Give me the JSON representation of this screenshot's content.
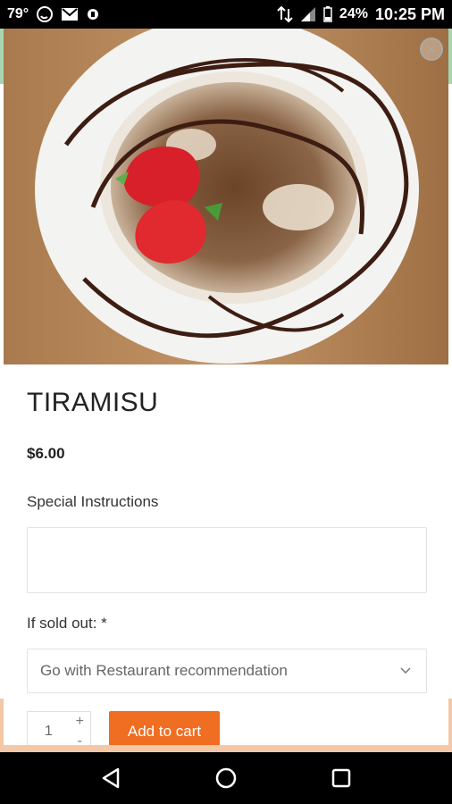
{
  "status_bar": {
    "temperature": "79°",
    "battery": "24%",
    "time": "10:25 PM",
    "icons": [
      "whatsapp-icon",
      "gmail-icon",
      "notification-icon",
      "data-transfer-icon",
      "signal-icon",
      "battery-icon"
    ]
  },
  "product": {
    "title": "TIRAMISU",
    "price": "$6.00"
  },
  "form": {
    "special_instructions_label": "Special Instructions",
    "special_instructions_value": "",
    "sold_out_label": "If sold out:",
    "sold_out_required": "*",
    "sold_out_selected": "Go with Restaurant recommendation"
  },
  "cart": {
    "quantity": "1",
    "plus": "+",
    "minus": "-",
    "add_label": "Add to cart"
  },
  "colors": {
    "accent": "#f06e22",
    "band_green": "#a7d5b1",
    "band_peach": "#f4c7a6"
  }
}
